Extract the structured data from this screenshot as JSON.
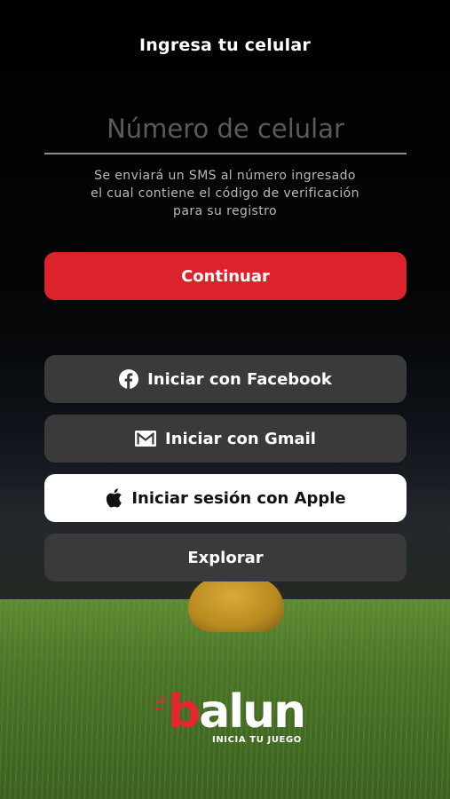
{
  "header": {
    "title": "Ingresa tu celular"
  },
  "phone": {
    "placeholder": "Número de celular",
    "value": ""
  },
  "note": {
    "line1": "Se enviará un SMS al número ingresado",
    "line2": "el cual contiene el código de verificación",
    "line3": "para su registro"
  },
  "buttons": {
    "continue": "Continuar",
    "facebook": "Iniciar con Facebook",
    "gmail": "Iniciar con Gmail",
    "apple": "Iniciar sesión con Apple",
    "explore": "Explorar"
  },
  "logo": {
    "word_b": "b",
    "word_rest": "alun",
    "tagline": "INICIA TU JUEGO"
  },
  "colors": {
    "accent": "#dc232c",
    "button_dark": "#3a3a3a",
    "button_light": "#ffffff",
    "background": "#000000"
  },
  "icons": [
    "facebook-icon",
    "mail-icon",
    "apple-icon"
  ]
}
